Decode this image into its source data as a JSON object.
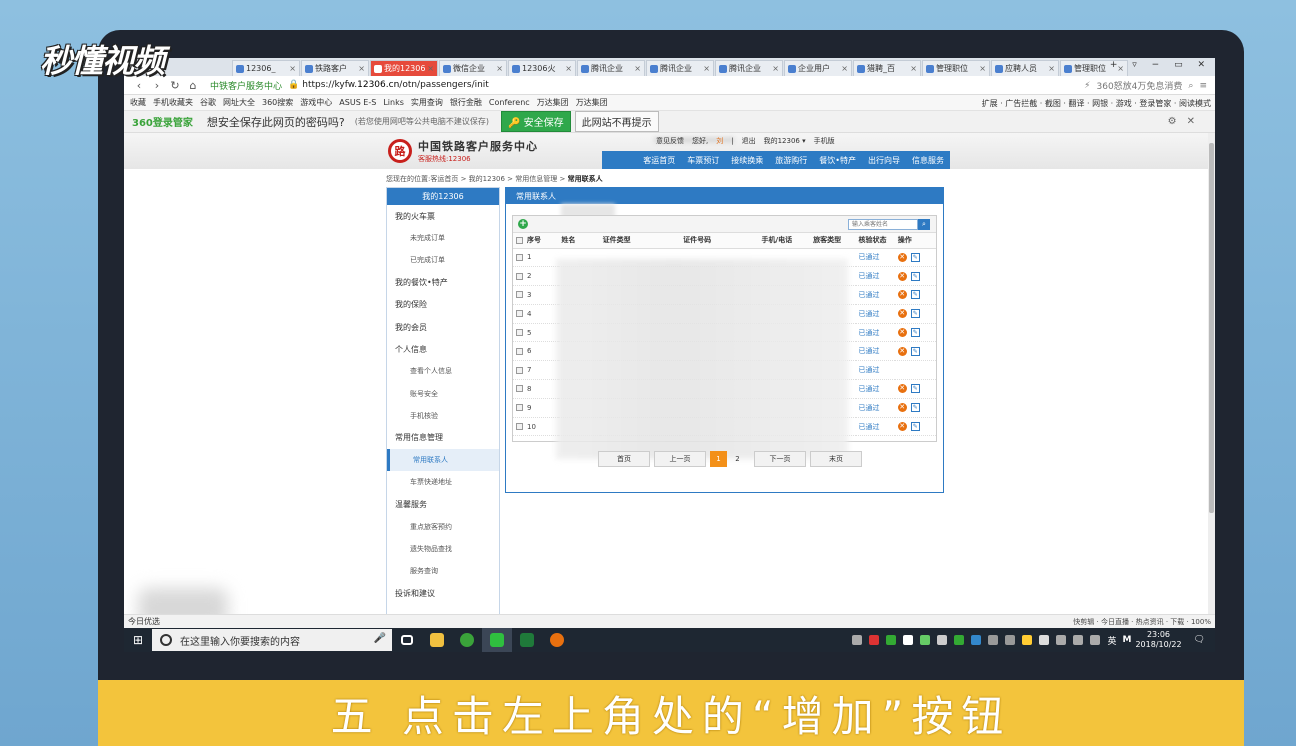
{
  "overlay": {
    "logo_text": "秒懂视频",
    "caption": "五 点击左上角处的“增加”按钮"
  },
  "browser": {
    "tabs": [
      {
        "label": "12306_",
        "active": false
      },
      {
        "label": "铁路客户",
        "active": false
      },
      {
        "label": "我的12306",
        "active": true
      },
      {
        "label": "微信企业",
        "active": false
      },
      {
        "label": "12306火",
        "active": false
      },
      {
        "label": "腾讯企业",
        "active": false
      },
      {
        "label": "腾讯企业",
        "active": false
      },
      {
        "label": "腾讯企业",
        "active": false
      },
      {
        "label": "企业用户",
        "active": false
      },
      {
        "label": "猎聘_百",
        "active": false
      },
      {
        "label": "管理职位",
        "active": false
      },
      {
        "label": "应聘人员",
        "active": false
      },
      {
        "label": "管理职位",
        "active": false
      }
    ],
    "site_name": "中铁客户服务中心",
    "url_prefix": "https://kyfw.",
    "url_domain": "12306.cn",
    "url_path": "/otn/passengers/init",
    "address_right_text": "360怒放4万免息消费",
    "bookmarks": [
      "收藏",
      "手机收藏夹",
      "谷歌",
      "网址大全",
      "360搜索",
      "游戏中心",
      "ASUS E-S",
      "Links",
      "实用查询",
      "银行金融",
      "Conferenc",
      "万达集团",
      "万达集团"
    ],
    "bookmark_right": "扩展 · 广告拦截 · 截图 · 翻译 · 网银 · 游戏 · 登录管家 · 阅读模式",
    "password_bar": {
      "logo": "360登录管家",
      "question": "想安全保存此网页的密码吗?",
      "note": "(若您使用网吧等公共电脑不建议保存)",
      "save_btn": "安全保存",
      "never_btn": "此网站不再提示"
    },
    "status_left": "今日优选",
    "status_right": "快剪辑 · 今日直播 · 热点资讯 · 下载 · 100%"
  },
  "site": {
    "title": "中国铁路客户服务中心",
    "hotline": "客服热线:12306",
    "top_links": [
      "意见反馈",
      "您好,",
      "刘",
      "|",
      "退出",
      "我的12306 ▾",
      "手机版"
    ],
    "nav": [
      "客运首页",
      "车票预订",
      "接续换乘",
      "旅游购行",
      "餐饮•特产",
      "出行向导",
      "信息服务"
    ],
    "breadcrumb_prefix": "您现在的位置:客运首页 > 我的12306 > 常用信息管理 > ",
    "breadcrumb_current": "常用联系人"
  },
  "sidebar": {
    "header": "我的12306",
    "items": [
      {
        "label": "我的火车票",
        "sub": false,
        "active": false
      },
      {
        "label": "未完成订单",
        "sub": true,
        "active": false
      },
      {
        "label": "已完成订单",
        "sub": true,
        "active": false
      },
      {
        "label": "我的餐饮•特产",
        "sub": false,
        "active": false
      },
      {
        "label": "我的保险",
        "sub": false,
        "active": false
      },
      {
        "label": "我的会员",
        "sub": false,
        "active": false
      },
      {
        "label": "个人信息",
        "sub": false,
        "active": false
      },
      {
        "label": "查看个人信息",
        "sub": true,
        "active": false
      },
      {
        "label": "账号安全",
        "sub": true,
        "active": false
      },
      {
        "label": "手机核验",
        "sub": true,
        "active": false
      },
      {
        "label": "常用信息管理",
        "sub": false,
        "active": false
      },
      {
        "label": "常用联系人",
        "sub": true,
        "active": true
      },
      {
        "label": "车票快递地址",
        "sub": true,
        "active": false
      },
      {
        "label": "温馨服务",
        "sub": false,
        "active": false
      },
      {
        "label": "重点旅客预约",
        "sub": true,
        "active": false
      },
      {
        "label": "遗失物品查找",
        "sub": true,
        "active": false
      },
      {
        "label": "服务查询",
        "sub": true,
        "active": false
      },
      {
        "label": "投诉和建议",
        "sub": false,
        "active": false
      }
    ]
  },
  "panel": {
    "header": "常用联系人",
    "search_placeholder": "输入乘客姓名",
    "columns": [
      "序号",
      "姓名",
      "证件类型",
      "证件号码",
      "手机/电话",
      "旅客类型",
      "核验状态",
      "操作"
    ],
    "rows": [
      {
        "no": "1",
        "status": "已通过",
        "actions": true
      },
      {
        "no": "2",
        "status": "已通过",
        "actions": true
      },
      {
        "no": "3",
        "status": "已通过",
        "actions": true
      },
      {
        "no": "4",
        "status": "已通过",
        "actions": true
      },
      {
        "no": "5",
        "status": "已通过",
        "actions": true
      },
      {
        "no": "6",
        "status": "已通过",
        "actions": true
      },
      {
        "no": "7",
        "status": "已通过",
        "actions": false
      },
      {
        "no": "8",
        "status": "已通过",
        "actions": true
      },
      {
        "no": "9",
        "status": "已通过",
        "actions": true
      },
      {
        "no": "10",
        "status": "已通过",
        "actions": true
      }
    ],
    "pager": {
      "first": "首页",
      "prev": "上一页",
      "pages": [
        "1",
        "2"
      ],
      "current": "1",
      "next": "下一页",
      "last": "末页"
    }
  },
  "taskbar": {
    "search_placeholder": "在这里输入你要搜索的内容",
    "time": "23:06",
    "date": "2018/10/22",
    "ime": "英"
  }
}
